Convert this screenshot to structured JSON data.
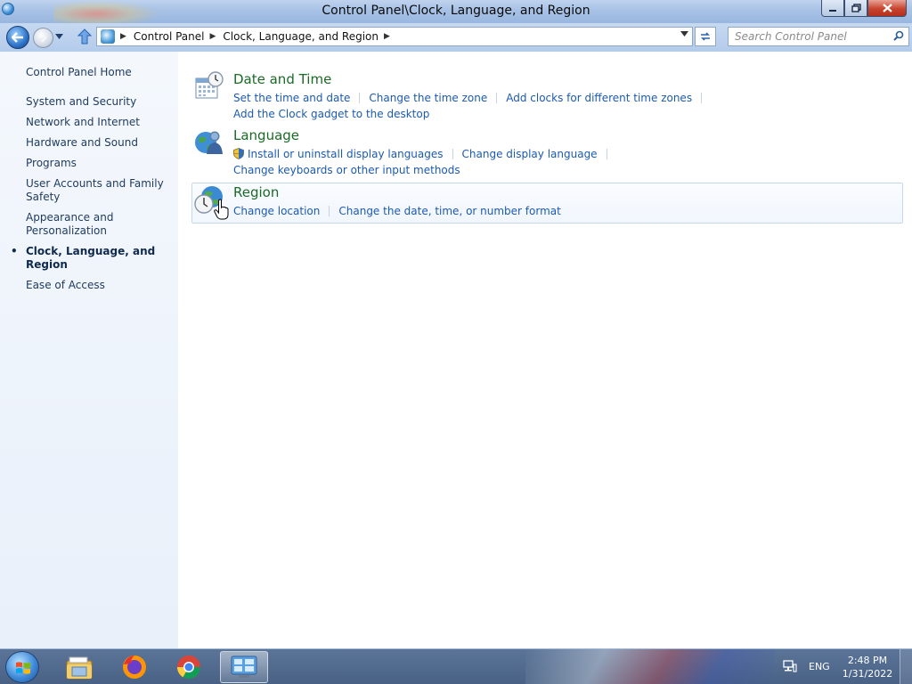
{
  "window": {
    "title": "Control Panel\\Clock, Language, and Region"
  },
  "address_bar": {
    "crumbs": [
      "Control Panel",
      "Clock, Language, and Region"
    ]
  },
  "search": {
    "placeholder": "Search Control Panel"
  },
  "sidebar": {
    "home": "Control Panel Home",
    "items": [
      {
        "label": "System and Security"
      },
      {
        "label": "Network and Internet"
      },
      {
        "label": "Hardware and Sound"
      },
      {
        "label": "Programs"
      },
      {
        "label": "User Accounts and Family Safety"
      },
      {
        "label": "Appearance and Personalization"
      },
      {
        "label": "Clock, Language, and Region",
        "current": true
      },
      {
        "label": "Ease of Access"
      }
    ]
  },
  "categories": [
    {
      "title": "Date and Time",
      "icon": "calendar-clock-icon",
      "links": [
        "Set the time and date",
        "Change the time zone",
        "Add clocks for different time zones",
        "Add the Clock gadget to the desktop"
      ]
    },
    {
      "title": "Language",
      "icon": "language-globe-icon",
      "links": [
        "Install or uninstall display languages",
        "Change display language",
        "Change keyboards or other input methods"
      ]
    },
    {
      "title": "Region",
      "icon": "region-globe-clock-icon",
      "links": [
        "Change location",
        "Change the date, time, or number format"
      ]
    }
  ],
  "taskbar": {
    "apps": [
      "windows-explorer-icon",
      "firefox-icon",
      "chrome-icon",
      "control-panel-icon"
    ],
    "language": "ENG",
    "time": "2:48 PM",
    "date": "1/31/2022"
  },
  "colors": {
    "link": "#1b5ab1",
    "category_title": "#1a6a26",
    "sidebar_bg": "#eef4fb"
  }
}
